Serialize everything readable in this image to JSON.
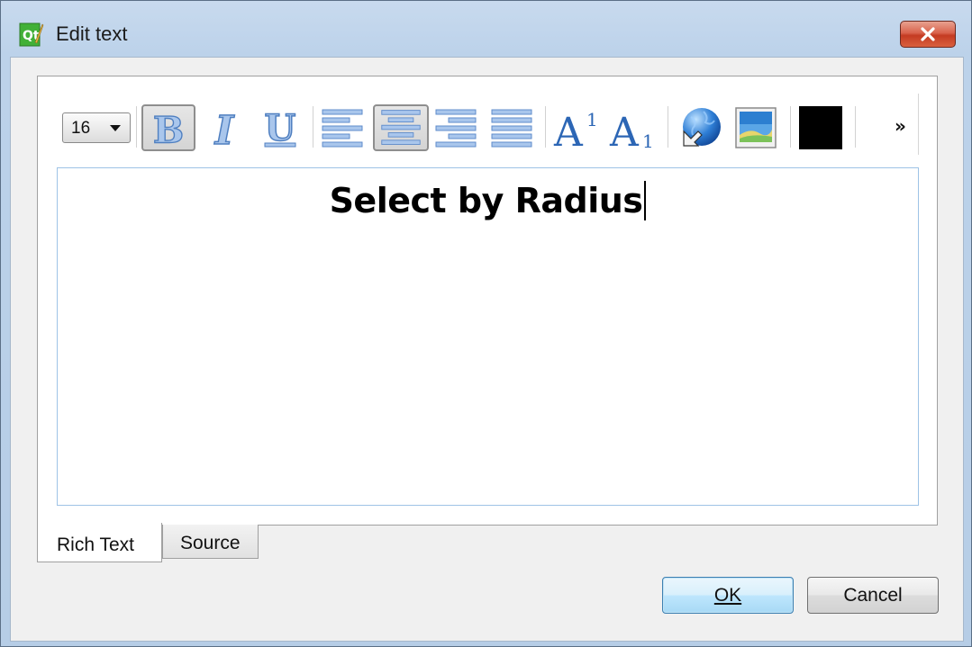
{
  "window": {
    "title": "Edit text"
  },
  "toolbar": {
    "font_size": "16",
    "more_label": "»",
    "text_color": "#000000",
    "buttons": [
      {
        "name": "bold",
        "pressed": true
      },
      {
        "name": "italic",
        "pressed": false
      },
      {
        "name": "underline",
        "pressed": false
      },
      {
        "name": "align-left",
        "pressed": false
      },
      {
        "name": "align-center",
        "pressed": true
      },
      {
        "name": "align-right",
        "pressed": false
      },
      {
        "name": "justify",
        "pressed": false
      },
      {
        "name": "superscript",
        "pressed": false
      },
      {
        "name": "subscript",
        "pressed": false
      },
      {
        "name": "insert-link",
        "pressed": false
      },
      {
        "name": "insert-image",
        "pressed": false
      },
      {
        "name": "text-color",
        "pressed": false
      }
    ]
  },
  "editor": {
    "content": "Select by Radius"
  },
  "tabs": [
    {
      "label": "Rich Text",
      "active": true
    },
    {
      "label": "Source",
      "active": false
    }
  ],
  "buttons": {
    "ok_label": "OK",
    "cancel_label": "Cancel"
  },
  "colors": {
    "accent": "#3c7fb1",
    "close": "#c43b22",
    "format_icon": "#5b8fcf"
  }
}
